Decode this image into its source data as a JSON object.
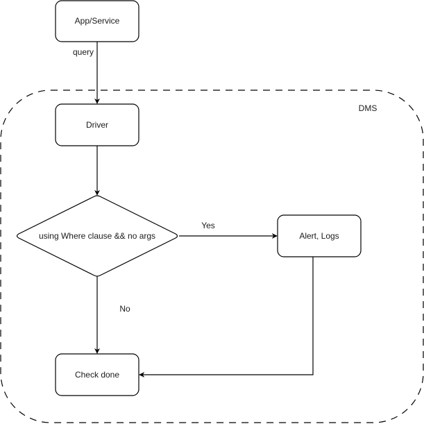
{
  "diagram": {
    "type": "flowchart",
    "container": {
      "label": "DMS",
      "style": "dashed"
    },
    "nodes": [
      {
        "id": "app",
        "label": "App/Service",
        "shape": "rounded-rect"
      },
      {
        "id": "driver",
        "label": "Driver",
        "shape": "rounded-rect"
      },
      {
        "id": "decision",
        "label": "using Where clause && no args",
        "shape": "diamond"
      },
      {
        "id": "alert",
        "label": "Alert, Logs",
        "shape": "rounded-rect"
      },
      {
        "id": "done",
        "label": "Check done",
        "shape": "rounded-rect"
      }
    ],
    "edges": [
      {
        "from": "app",
        "to": "driver",
        "label": "query"
      },
      {
        "from": "driver",
        "to": "decision",
        "label": ""
      },
      {
        "from": "decision",
        "to": "alert",
        "label": "Yes"
      },
      {
        "from": "decision",
        "to": "done",
        "label": "No"
      },
      {
        "from": "alert",
        "to": "done",
        "label": ""
      }
    ]
  }
}
